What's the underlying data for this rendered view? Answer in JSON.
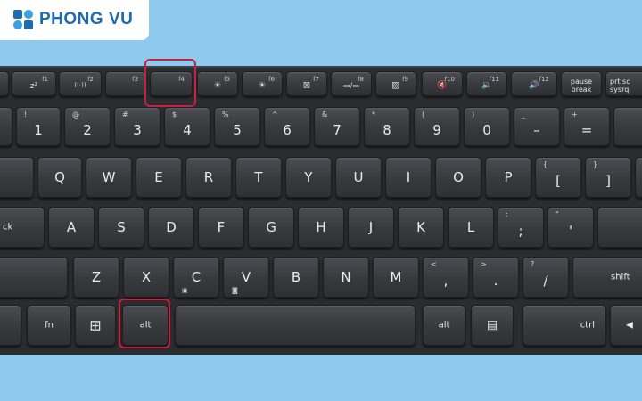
{
  "brand": {
    "name": "PHONG VU",
    "color": "#1d6bb3"
  },
  "colors": {
    "background": "#8ec9ee",
    "keyboard": "#2a2c30",
    "highlight": "#c4233f"
  },
  "highlighted_keys": [
    "f4",
    "alt"
  ],
  "keys": {
    "f2_main": "z²",
    "f2_fn": "f1",
    "f3_fn": "f2",
    "f3_icon": "((·))",
    "f4_fn": "f3",
    "f5_fn": "f4",
    "f6_fn": "f5",
    "f6_icon": "☀",
    "f7_fn": "f6",
    "f7_icon": "☀",
    "f8_fn": "f7",
    "f8_icon": "⊠",
    "f9_fn": "f8",
    "f9_icon": "▭/▭",
    "f10_fn": "f9",
    "f10_icon": "▨",
    "f11_fn": "f10",
    "f11_icon": "🔇",
    "f12_fn": "f11",
    "f12_icon": "🔉",
    "f13_fn": "f12",
    "f13_icon": "🔊",
    "pause": "pause break",
    "prtsc": "prt sc sysrq",
    "n1_main": "1",
    "n1_sec": "!",
    "n2_main": "2",
    "n2_sec": "@",
    "n3_main": "3",
    "n3_sec": "#",
    "n4_main": "4",
    "n4_sec": "$",
    "n5_main": "5",
    "n5_sec": "%",
    "n6_main": "6",
    "n6_sec": "^",
    "n7_main": "7",
    "n7_sec": "&",
    "n8_main": "8",
    "n8_sec": "*",
    "n9_main": "9",
    "n9_sec": "(",
    "n0_main": "0",
    "n0_sec": ")",
    "minus_main": "–",
    "minus_sec": "_",
    "equals_main": "=",
    "equals_sec": "+",
    "q": "Q",
    "w": "W",
    "e": "E",
    "r": "R",
    "t": "T",
    "y": "Y",
    "u": "U",
    "i": "I",
    "o": "O",
    "p": "P",
    "lbracket_main": "[",
    "lbracket_sec": "{",
    "rbracket_main": "]",
    "rbracket_sec": "}",
    "caps": "ck",
    "a": "A",
    "s": "S",
    "d": "D",
    "f": "F",
    "g": "G",
    "h": "H",
    "j": "J",
    "k": "K",
    "l": "L",
    "semicolon_main": ";",
    "semicolon_sec": ":",
    "quote_main": "'",
    "quote_sec": "\"",
    "z": "Z",
    "x": "X",
    "c": "C",
    "v": "V",
    "b": "B",
    "n": "N",
    "m": "M",
    "comma_main": ",",
    "comma_sec": "<",
    "period_main": ".",
    "period_sec": ">",
    "slash_main": "/",
    "slash_sec": "?",
    "shift_right": "shift",
    "fn": "fn",
    "win_icon": "⊞",
    "alt_left": "alt",
    "alt_right": "alt",
    "menu_icon": "▤",
    "ctrl_right": "ctrl",
    "arrow_left": "◀"
  }
}
